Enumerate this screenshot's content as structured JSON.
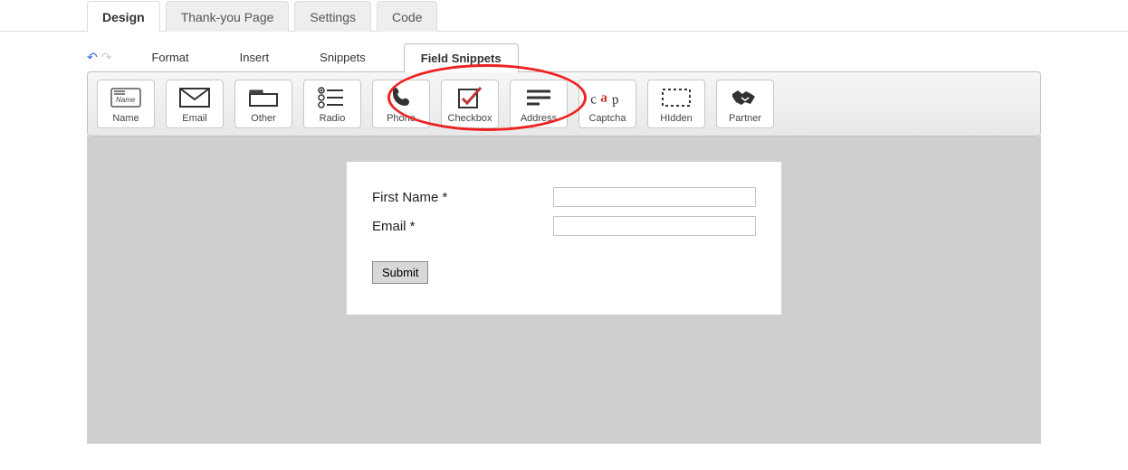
{
  "nav": {
    "tabs": [
      {
        "label": "Design",
        "active": true
      },
      {
        "label": "Thank-you Page",
        "active": false
      },
      {
        "label": "Settings",
        "active": false
      },
      {
        "label": "Code",
        "active": false
      }
    ]
  },
  "menu": {
    "items": [
      "Format",
      "Insert",
      "Snippets"
    ],
    "ribbon_tab": "Field Snippets"
  },
  "tools": [
    {
      "key": "name",
      "label": "Name"
    },
    {
      "key": "email",
      "label": "Email"
    },
    {
      "key": "other",
      "label": "Other"
    },
    {
      "key": "radio",
      "label": "Radio"
    },
    {
      "key": "phone",
      "label": "Phone"
    },
    {
      "key": "checkbox",
      "label": "Checkbox"
    },
    {
      "key": "address",
      "label": "Address"
    },
    {
      "key": "captcha",
      "label": "Captcha"
    },
    {
      "key": "hidden",
      "label": "HIdden"
    },
    {
      "key": "partner",
      "label": "Partner"
    }
  ],
  "form": {
    "fields": [
      {
        "label": "First Name *",
        "value": ""
      },
      {
        "label": "Email *",
        "value": ""
      }
    ],
    "submit_label": "Submit"
  }
}
